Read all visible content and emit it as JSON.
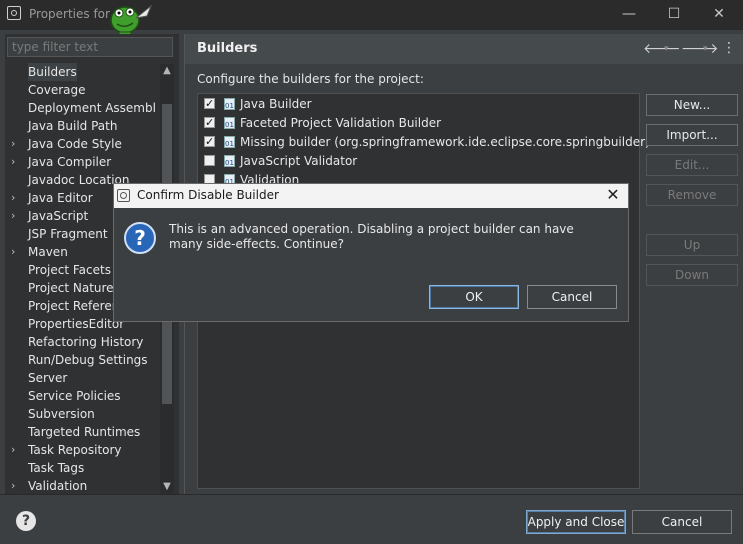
{
  "window": {
    "title": "Properties for",
    "minimize": "—",
    "maximize": "☐",
    "close": "✕"
  },
  "left": {
    "filter_placeholder": "type filter text",
    "tree": [
      {
        "label": "Builders",
        "expandable": false,
        "selected": true
      },
      {
        "label": "Coverage",
        "expandable": false
      },
      {
        "label": "Deployment Assembly",
        "expandable": false
      },
      {
        "label": "Java Build Path",
        "expandable": false
      },
      {
        "label": "Java Code Style",
        "expandable": true
      },
      {
        "label": "Java Compiler",
        "expandable": true
      },
      {
        "label": "Javadoc Location",
        "expandable": false
      },
      {
        "label": "Java Editor",
        "expandable": true
      },
      {
        "label": "JavaScript",
        "expandable": true
      },
      {
        "label": "JSP Fragment",
        "expandable": false
      },
      {
        "label": "Maven",
        "expandable": true
      },
      {
        "label": "Project Facets",
        "expandable": false
      },
      {
        "label": "Project Natures",
        "expandable": false
      },
      {
        "label": "Project References",
        "expandable": false
      },
      {
        "label": "PropertiesEditor",
        "expandable": false
      },
      {
        "label": "Refactoring History",
        "expandable": false
      },
      {
        "label": "Run/Debug Settings",
        "expandable": false
      },
      {
        "label": "Server",
        "expandable": false
      },
      {
        "label": "Service Policies",
        "expandable": false
      },
      {
        "label": "Subversion",
        "expandable": false
      },
      {
        "label": "Targeted Runtimes",
        "expandable": false
      },
      {
        "label": "Task Repository",
        "expandable": true
      },
      {
        "label": "Task Tags",
        "expandable": false
      },
      {
        "label": "Validation",
        "expandable": true
      }
    ]
  },
  "page": {
    "title": "Builders",
    "description": "Configure the builders for the project:",
    "builders": [
      {
        "name": "Java Builder",
        "checked": true
      },
      {
        "name": "Faceted Project Validation Builder",
        "checked": true
      },
      {
        "name": "Missing builder (org.springframework.ide.eclipse.core.springbuilder)",
        "checked": true
      },
      {
        "name": "JavaScript Validator",
        "checked": false
      },
      {
        "name": "Validation",
        "checked": false
      }
    ],
    "buttons": {
      "new": "New...",
      "import": "Import...",
      "edit": "Edit...",
      "remove": "Remove",
      "up": "Up",
      "down": "Down"
    }
  },
  "footer": {
    "help": "?",
    "apply_close": "Apply and Close",
    "cancel": "Cancel"
  },
  "dialog": {
    "title": "Confirm Disable Builder",
    "message": "This is an advanced operation. Disabling a project builder can have many side-effects. Continue?",
    "ok": "OK",
    "cancel": "Cancel",
    "close": "✕"
  }
}
